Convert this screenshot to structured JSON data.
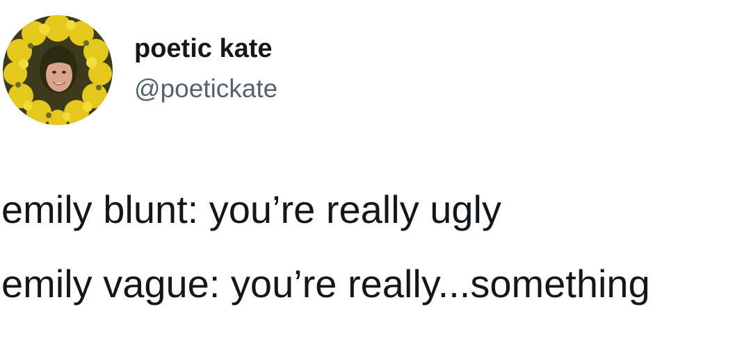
{
  "profile": {
    "display_name": "poetic kate",
    "handle": "@poetickate",
    "avatar_icon": "avatar-photo-flower-wreath",
    "avatar_colors": {
      "flowers": "#e4c81c",
      "dark": "#2d2a12",
      "face": "#d9a58a"
    }
  },
  "tweet": {
    "lines": [
      "emily blunt: you’re really ugly",
      "emily vague: you’re really...something"
    ]
  },
  "colors": {
    "text": "#14171a",
    "handle": "#536471",
    "background": "#ffffff"
  }
}
